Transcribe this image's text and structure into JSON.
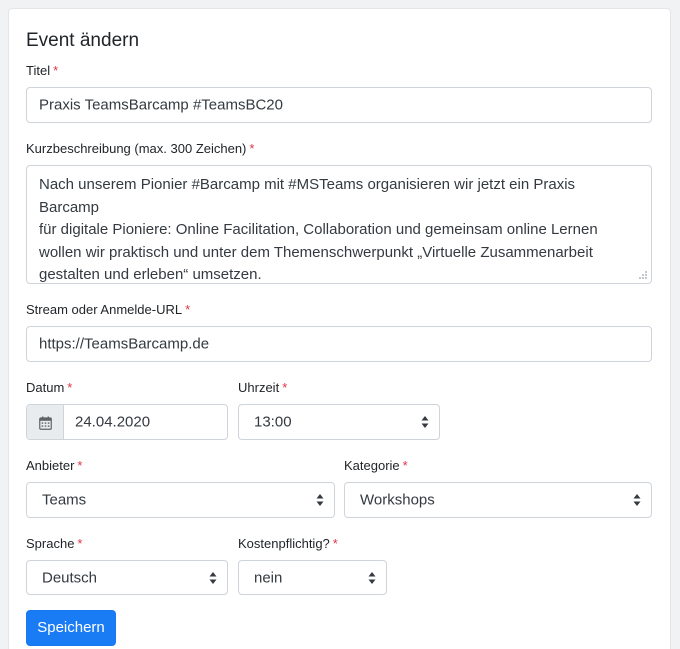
{
  "form": {
    "heading": "Event ändern",
    "required_marker": "*",
    "title": {
      "label": "Titel",
      "value": "Praxis TeamsBarcamp #TeamsBC20"
    },
    "description": {
      "label": "Kurzbeschreibung (max. 300 Zeichen)",
      "lines": [
        "Nach unserem Pionier #Barcamp mit #MSTeams organisieren wir jetzt ein Praxis Barcamp",
        "für digitale Pioniere: Online Facilitation, Collaboration und gemeinsam online Lernen",
        "wollen wir praktisch und unter dem Themenschwerpunkt „Virtuelle Zusammenarbeit",
        "gestalten und erleben“ umsetzen."
      ]
    },
    "url": {
      "label": "Stream oder Anmelde-URL",
      "value": "https://TeamsBarcamp.de"
    },
    "date": {
      "label": "Datum",
      "value": "24.04.2020",
      "icon": "calendar-icon"
    },
    "time": {
      "label": "Uhrzeit",
      "value": "13:00"
    },
    "provider": {
      "label": "Anbieter",
      "value": "Teams"
    },
    "category": {
      "label": "Kategorie",
      "value": "Workshops"
    },
    "language": {
      "label": "Sprache",
      "value": "Deutsch"
    },
    "paid": {
      "label": "Kostenpflichtig?",
      "value": "nein"
    },
    "save_label": "Speichern"
  },
  "colors": {
    "accent": "#1a7cf5",
    "required": "#dc3545",
    "border": "#ced4da",
    "addon_bg": "#e9ecef"
  }
}
